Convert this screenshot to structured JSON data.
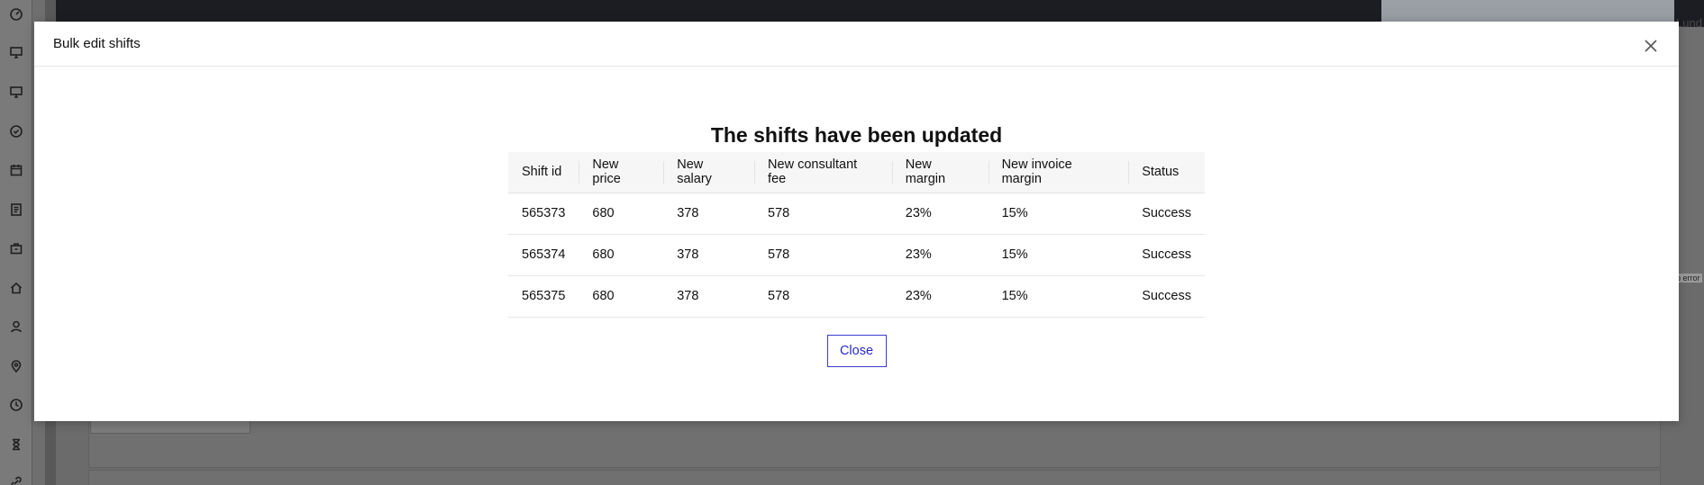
{
  "modal": {
    "title": "Bulk edit shifts",
    "heading": "The shifts have been updated",
    "close_button_label": "Close"
  },
  "table": {
    "headers": [
      "Shift id",
      "New price",
      "New salary",
      "New consultant fee",
      "New margin",
      "New invoice margin",
      "Status"
    ],
    "rows": [
      [
        "565373",
        "680",
        "378",
        "578",
        "23%",
        "15%",
        "Success"
      ],
      [
        "565374",
        "680",
        "378",
        "578",
        "23%",
        "15%",
        "Success"
      ],
      [
        "565375",
        "680",
        "378",
        "578",
        "23%",
        "15%",
        "Success"
      ]
    ]
  },
  "background": {
    "photo_label": "Lund",
    "map_error": "p error"
  },
  "sidebar_icons": [
    "dashboard-icon",
    "monitor-icon",
    "monitor-icon",
    "check-circle-icon",
    "calendar-icon",
    "document-icon",
    "bag-icon",
    "home-icon",
    "user-icon",
    "location-pin-icon",
    "clock-icon",
    "hourglass-icon",
    "link-icon"
  ],
  "colors": {
    "accent": "#2a2ac8",
    "overlay": "#6f6f6f",
    "header_bg": "#f6f6f6"
  }
}
